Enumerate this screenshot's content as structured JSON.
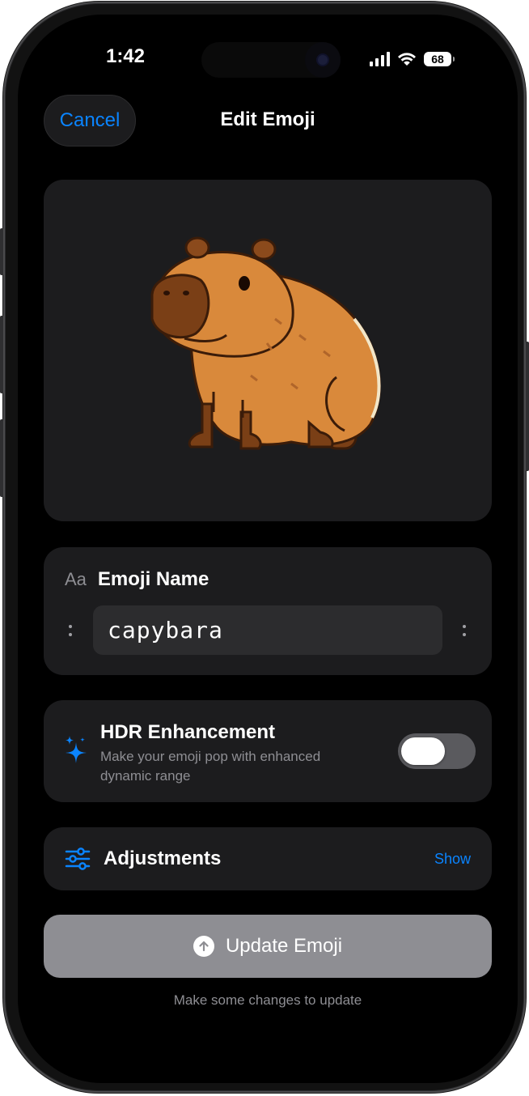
{
  "status": {
    "time": "1:42",
    "battery": "68"
  },
  "nav": {
    "cancel_label": "Cancel",
    "title": "Edit Emoji"
  },
  "emoji_name": {
    "icon_text": "Aa",
    "label": "Emoji Name",
    "value": "capybara"
  },
  "hdr": {
    "title": "HDR Enhancement",
    "subtitle": "Make your emoji pop with enhanced dynamic range",
    "enabled": false
  },
  "adjustments": {
    "title": "Adjustments",
    "toggle_label": "Show"
  },
  "update": {
    "button_label": "Update Emoji",
    "note": "Make some changes to update"
  },
  "icons": {
    "sparkle": "sparkles-icon",
    "sliders": "sliders-icon",
    "upload": "arrow-up-circle-icon",
    "cellular": "cellular-signal-icon",
    "wifi": "wifi-icon",
    "battery": "battery-icon"
  },
  "colors": {
    "accent": "#0a84ff",
    "card": "#1c1c1e",
    "background": "#000000",
    "button_disabled": "#8e8e93"
  }
}
